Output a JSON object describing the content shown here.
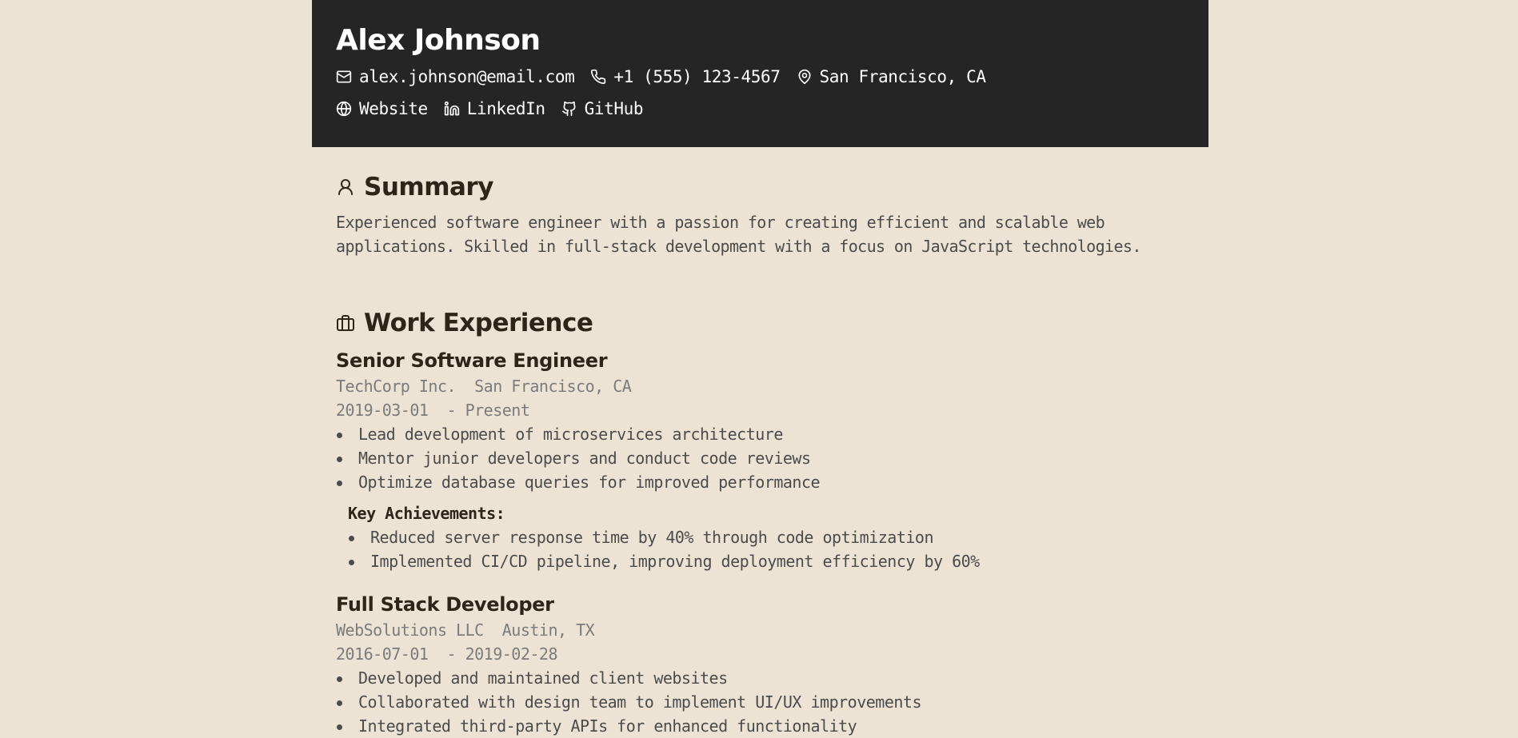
{
  "header": {
    "name": "Alex Johnson",
    "email": "alex.johnson@email.com",
    "phone": "+1 (555) 123-4567",
    "location": "San Francisco, CA",
    "links": {
      "website": "Website",
      "linkedin": "LinkedIn",
      "github": "GitHub"
    }
  },
  "summary": {
    "title": "Summary",
    "text": "Experienced software engineer with a passion for creating efficient and scalable web applications. Skilled in full-stack development with a focus on JavaScript technologies."
  },
  "experience": {
    "title": "Work Experience",
    "jobs": [
      {
        "title": "Senior Software Engineer",
        "company": "TechCorp Inc.",
        "location": "San Francisco, CA",
        "start": "2019-03-01",
        "end": "- Present",
        "bullets": [
          "Lead development of microservices architecture",
          "Mentor junior developers and conduct code reviews",
          "Optimize database queries for improved performance"
        ],
        "achievements_title": "Key Achievements:",
        "achievements": [
          "Reduced server response time by 40% through code optimization",
          "Implemented CI/CD pipeline, improving deployment efficiency by 60%"
        ]
      },
      {
        "title": "Full Stack Developer",
        "company": "WebSolutions LLC",
        "location": "Austin, TX",
        "start": "2016-07-01",
        "end": "- 2019-02-28",
        "bullets": [
          "Developed and maintained client websites",
          "Collaborated with design team to implement UI/UX improvements",
          "Integrated third-party APIs for enhanced functionality"
        ]
      }
    ]
  },
  "colors": {
    "background": "#ede3d5",
    "header_background": "#252525",
    "heading": "#2f2418",
    "body_text": "#4b4b4b",
    "muted_text": "#7b7b7b"
  },
  "icons": {
    "email": "mail-icon",
    "phone": "phone-icon",
    "location": "map-pin-icon",
    "website": "globe-icon",
    "linkedin": "linkedin-icon",
    "github": "github-icon",
    "summary": "user-icon",
    "experience": "briefcase-icon"
  }
}
